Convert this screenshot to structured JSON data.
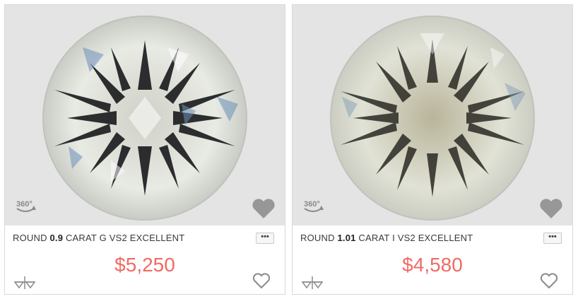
{
  "listings": [
    {
      "shape": "ROUND",
      "carat": "0.9",
      "carat_label": "CARAT",
      "color": "G",
      "clarity": "VS2",
      "cut": "EXCELLENT",
      "price": "$5,250",
      "view_360_label": "360°",
      "more_label": "•••"
    },
    {
      "shape": "ROUND",
      "carat": "1.01",
      "carat_label": "CARAT",
      "color": "I",
      "clarity": "VS2",
      "cut": "EXCELLENT",
      "price": "$4,580",
      "view_360_label": "360°",
      "more_label": "•••"
    }
  ],
  "colors": {
    "price": "#f06a64",
    "photo_bg": "#e4e4e4",
    "icon_gray": "#8a8a8a"
  },
  "icons": {
    "view_360": "360-icon",
    "favorite_overlay": "heart-overlay-icon",
    "compare": "compare-icon",
    "favorite": "heart-icon",
    "more": "more-icon"
  }
}
